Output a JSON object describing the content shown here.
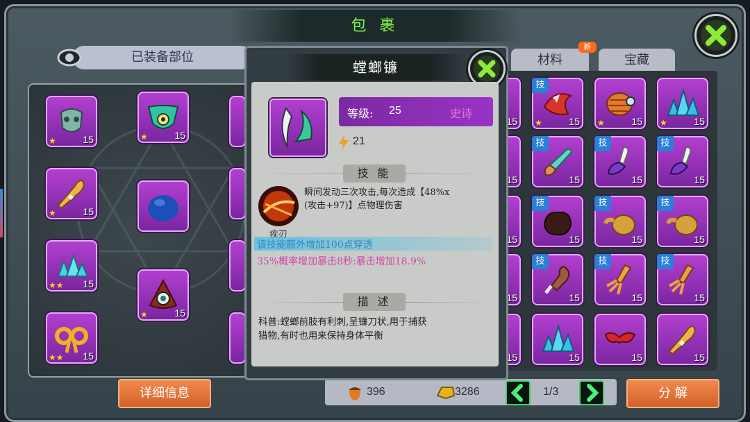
{
  "window": {
    "title": "包 裹"
  },
  "equipped": {
    "tab_label": "已装备部位",
    "slots": [
      {
        "level": "15",
        "stars": "★",
        "skill": ""
      },
      {
        "level": "15",
        "stars": "★",
        "skill": ""
      },
      {
        "level": "15",
        "stars": "★",
        "skill": ""
      },
      {
        "level": "",
        "stars": "",
        "skill": ""
      },
      {
        "level": "15",
        "stars": "★★",
        "skill": ""
      },
      {
        "level": "15",
        "stars": "★",
        "skill": ""
      },
      {
        "level": "15",
        "stars": "★★",
        "skill": ""
      }
    ]
  },
  "tabs": {
    "materials": "材料",
    "treasure": "宝藏",
    "new_badge": "新"
  },
  "inventory_grid": [
    {
      "level": "15",
      "stars": "★",
      "skill": "技"
    },
    {
      "level": "15",
      "stars": "★",
      "skill": ""
    },
    {
      "level": "15",
      "stars": "★",
      "skill": ""
    },
    {
      "level": "15",
      "stars": "",
      "skill": "技"
    },
    {
      "level": "15",
      "stars": "",
      "skill": "技"
    },
    {
      "level": "15",
      "stars": "",
      "skill": "技"
    },
    {
      "level": "15",
      "stars": "",
      "skill": "技"
    },
    {
      "level": "15",
      "stars": "",
      "skill": "技"
    },
    {
      "level": "15",
      "stars": "",
      "skill": "技"
    },
    {
      "level": "15",
      "stars": "",
      "skill": "技"
    },
    {
      "level": "15",
      "stars": "",
      "skill": "技"
    },
    {
      "level": "15",
      "stars": "",
      "skill": "技"
    },
    {
      "level": "15",
      "stars": "",
      "skill": ""
    },
    {
      "level": "15",
      "stars": "",
      "skill": ""
    },
    {
      "level": "15",
      "stars": "",
      "skill": ""
    }
  ],
  "grid_partial_levels": [
    "15",
    "15",
    "15",
    "15",
    "15"
  ],
  "bottom": {
    "details_button": "详细信息",
    "decompose_button": "分 解",
    "acorns": "396",
    "gold": "3286",
    "page": "1/3"
  },
  "popup": {
    "title": "螳螂镰",
    "level_label": "等级:",
    "level_value": "25",
    "rarity": "史诗",
    "power": "21",
    "skill_header": "技 能",
    "skill_desc_line1": "瞬间发动三次攻击,每次造成【48%x",
    "skill_desc_line2": "(攻击+97)】点物理伤害",
    "skill_name": "疾刃",
    "bonus_line1": "该技能额外增加100点穿透",
    "bonus_line2": "35%概率增加暴击8秒:暴击增加18.9%",
    "desc_header": "描 述",
    "desc_line1": "科普:螳螂前肢有利刺,呈镰刀状,用于捕获",
    "desc_line2": "猎物,有时也用来保持身体平衡"
  },
  "colors": {
    "title_green": "#7cf24d",
    "slot_purple": "#9a33c6",
    "bonus_cyan": "#3aa0c8",
    "bonus_pink": "#d04aa8"
  }
}
